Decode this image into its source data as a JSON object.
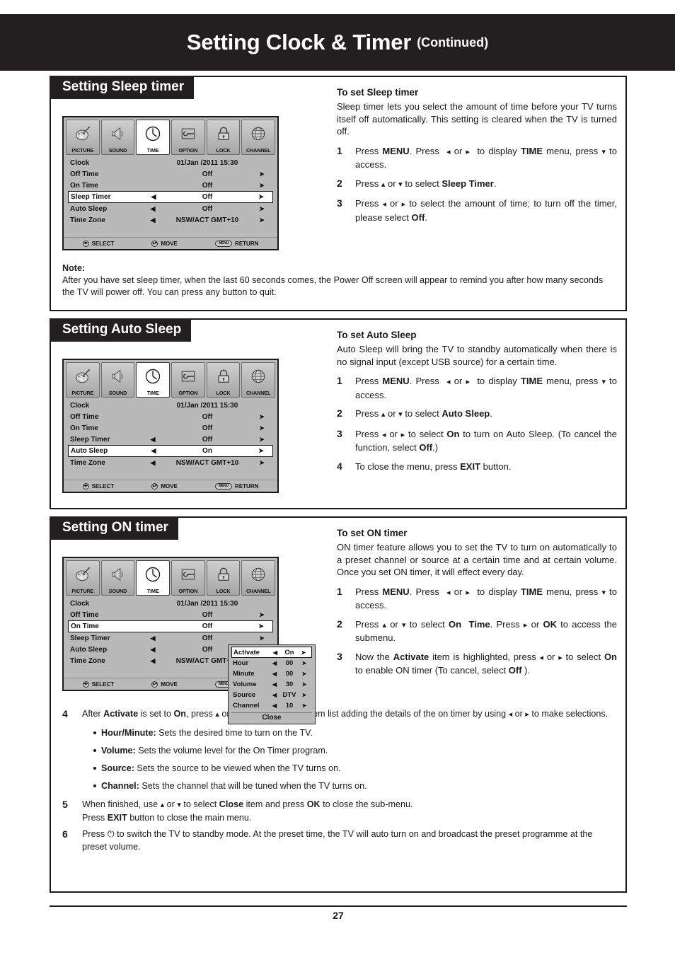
{
  "header": {
    "title": "Setting Clock & Timer",
    "continued": "(Continued)"
  },
  "page_number": "27",
  "osd_common": {
    "tabs": [
      {
        "label": "PICTURE",
        "icon": "palette-icon",
        "active": false
      },
      {
        "label": "SOUND",
        "icon": "speaker-icon",
        "active": false
      },
      {
        "label": "TIME",
        "icon": "clock-icon",
        "active": true
      },
      {
        "label": "OPTION",
        "icon": "wrench-screen-icon",
        "active": false
      },
      {
        "label": "LOCK",
        "icon": "padlock-icon",
        "active": false
      },
      {
        "label": "CHANNEL",
        "icon": "globe-icon",
        "active": false
      }
    ],
    "footer": {
      "select_keys": "◂▸",
      "select_label": "SELECT",
      "move_keys": "▴▾",
      "move_label": "MOVE",
      "return_key": "MENU",
      "return_label": "RETURN"
    },
    "left_arrow": "◀",
    "right_arrow": "➤"
  },
  "section1": {
    "heading": "Setting Sleep timer",
    "osd_rows": [
      {
        "name": "Clock",
        "left": "",
        "value": "01/Jan  /2011 15:30",
        "right": "",
        "highlight": false
      },
      {
        "name": "Off Time",
        "left": "",
        "value": "Off",
        "right": "➤",
        "highlight": false
      },
      {
        "name": "On Time",
        "left": "",
        "value": "Off",
        "right": "➤",
        "highlight": false
      },
      {
        "name": "Sleep Timer",
        "left": "◀",
        "value": "Off",
        "right": "➤",
        "highlight": true
      },
      {
        "name": "Auto Sleep",
        "left": "◀",
        "value": "Off",
        "right": "➤",
        "highlight": false
      },
      {
        "name": "Time Zone",
        "left": "◀",
        "value": "NSW/ACT GMT+10",
        "right": "➤",
        "highlight": false
      }
    ],
    "right_title": "To set Sleep timer",
    "right_intro": "Sleep timer lets you select the amount of time before your TV turns itself off automatically. This setting is cleared when the TV is turned off.",
    "steps": [
      {
        "num": "1",
        "html": "Press <b>MENU</b>. Press&nbsp; <span class=\"arr\">◂</span> or <span class=\"arr\">▸</span>&nbsp; to display <b>TIME</b> menu, press <span class=\"arr\">▾</span> to access."
      },
      {
        "num": "2",
        "html": "Press <span class=\"arr\">▴</span> or <span class=\"arr\">▾</span> to select <b>Sleep Timer</b>."
      },
      {
        "num": "3",
        "html": "Press <span class=\"arr\">◂</span> or <span class=\"arr\">▸</span> to select the amount of time; to turn off the timer, please select <b>Off</b>."
      }
    ],
    "note_heading": "Note:",
    "note_text": "After you have set sleep timer, when the last 60 seconds comes, the Power Off screen will appear to remind you after how many seconds the TV will power off. You can press any button to quit."
  },
  "section2": {
    "heading": "Setting Auto Sleep",
    "osd_rows": [
      {
        "name": "Clock",
        "left": "",
        "value": "01/Jan  /2011 15:30",
        "right": "",
        "highlight": false
      },
      {
        "name": "Off Time",
        "left": "",
        "value": "Off",
        "right": "➤",
        "highlight": false
      },
      {
        "name": "On Time",
        "left": "",
        "value": "Off",
        "right": "➤",
        "highlight": false
      },
      {
        "name": "Sleep Timer",
        "left": "◀",
        "value": "Off",
        "right": "➤",
        "highlight": false
      },
      {
        "name": "Auto Sleep",
        "left": "◀",
        "value": "On",
        "right": "➤",
        "highlight": true
      },
      {
        "name": "Time Zone",
        "left": "◀",
        "value": "NSW/ACT GMT+10",
        "right": "➤",
        "highlight": false
      }
    ],
    "right_title": "To set Auto Sleep",
    "right_intro": "Auto Sleep will bring the TV to standby automatically when there is no signal input (except USB source) for a certain time.",
    "steps": [
      {
        "num": "1",
        "html": "Press <b>MENU</b>. Press&nbsp; <span class=\"arr\">◂</span> or <span class=\"arr\">▸</span>&nbsp; to display <b>TIME</b> menu, press <span class=\"arr\">▾</span> to access."
      },
      {
        "num": "2",
        "html": "Press <span class=\"arr\">▴</span> or <span class=\"arr\">▾</span> to select <b>Auto Sleep</b>."
      },
      {
        "num": "3",
        "html": "Press <span class=\"arr\">◂</span> or <span class=\"arr\">▸</span> to select <b>On</b> to turn on Auto Sleep. (To cancel the function, select <b>Off</b>.)"
      },
      {
        "num": "4",
        "html": "To close the menu, press <b>EXIT</b> button."
      }
    ]
  },
  "section3": {
    "heading": "Setting ON timer",
    "osd_rows": [
      {
        "name": "Clock",
        "left": "",
        "value": "01/Jan  /2011 15:30",
        "right": "",
        "highlight": false
      },
      {
        "name": "Off Time",
        "left": "",
        "value": "Off",
        "right": "➤",
        "highlight": false
      },
      {
        "name": "On Time",
        "left": "",
        "value": "Off",
        "right": "➤",
        "highlight": true
      },
      {
        "name": "Sleep Timer",
        "left": "◀",
        "value": "Off",
        "right": "➤",
        "highlight": false
      },
      {
        "name": "Auto Sleep",
        "left": "◀",
        "value": "Off",
        "right": "➤",
        "highlight": false
      },
      {
        "name": "Time Zone",
        "left": "◀",
        "value": "NSW/ACT GMT+10",
        "right": "➤",
        "highlight": false
      }
    ],
    "popup": {
      "rows": [
        {
          "name": "Activate",
          "left": "◀",
          "value": "On",
          "right": "➤",
          "highlight": true
        },
        {
          "name": "Hour",
          "left": "◀",
          "value": "00",
          "right": "➤",
          "highlight": false
        },
        {
          "name": "Minute",
          "left": "◀",
          "value": "00",
          "right": "➤",
          "highlight": false
        },
        {
          "name": "Volume",
          "left": "◀",
          "value": "30",
          "right": "➤",
          "highlight": false
        },
        {
          "name": "Source",
          "left": "◀",
          "value": "DTV",
          "right": "➤",
          "highlight": false
        },
        {
          "name": "Channel",
          "left": "◀",
          "value": "10",
          "right": "➤",
          "highlight": false
        }
      ],
      "close_label": "Close"
    },
    "right_title": "To set ON timer",
    "right_intro": "ON timer feature allows you to set the TV to turn on automatically to a preset channel or source at a certain time and at certain volume. Once you set ON timer, it will effect every day.",
    "steps": [
      {
        "num": "1",
        "html": "Press <b>MENU</b>. Press&nbsp; <span class=\"arr\">◂</span> or <span class=\"arr\">▸</span>&nbsp; to display <b>TIME</b> menu, press <span class=\"arr\">▾</span> to access."
      },
      {
        "num": "2",
        "html": "Press <span class=\"arr\">▴</span> or <span class=\"arr\">▾</span> to select <b>On&nbsp; Time</b>. Press <span class=\"arr\">▸</span> or <b>OK</b> to access the submenu."
      },
      {
        "num": "3",
        "html": "Now the <b>Activate</b> item is highlighted, press <span class=\"arr\">◂</span> or <span class=\"arr\">▸</span> to select <b>On</b> to enable ON timer (To cancel, select <b>Off</b> )."
      }
    ],
    "bottom_steps": [
      {
        "num": "4",
        "html": "After <b>Activate</b> is set to <b>On</b>, press <span class=\"arr\">▴</span> or <span class=\"arr\">▾</span> to go through the item list adding the details of the on timer by using <span class=\"arr\">◂</span> or <span class=\"arr\">▸</span> to make selections."
      }
    ],
    "bullets": [
      {
        "html": "<b>Hour/Minute:</b> Sets the desired time to turn on the TV."
      },
      {
        "html": "<b>Volume:</b> Sets the volume level for the On Timer program."
      },
      {
        "html": "<b>Source:</b> Sets the source to be viewed when the TV turns on."
      },
      {
        "html": "<b>Channel:</b> Sets the channel that will be tuned when the TV turns on."
      }
    ],
    "bottom_steps_2": [
      {
        "num": "5",
        "html": "When finished, use <span class=\"arr\">▴</span> or <span class=\"arr\">▾</span> to select <b>Close</b> item and press <b>OK</b> to close the sub-menu.<br>Press <b>EXIT</b> button to close the main menu."
      },
      {
        "num": "6",
        "html": "Press ⏻ to switch the TV to standby mode. At the preset time, the TV will auto turn on and broadcast the preset programme at the preset volume."
      }
    ]
  }
}
